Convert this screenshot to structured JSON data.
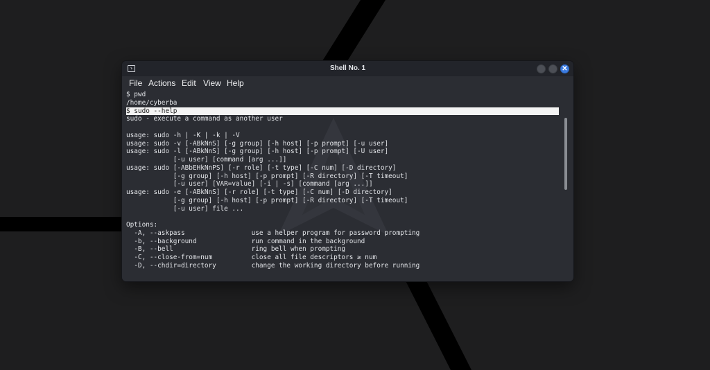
{
  "window": {
    "title": "Shell No. 1",
    "close_symbol": "✕",
    "icons": [
      "terminal-icon",
      "minimize-icon",
      "maximize-icon",
      "close-icon"
    ],
    "accent_color": "#3b7be0"
  },
  "menu": {
    "file": "File",
    "actions": "Actions",
    "edit": "Edit",
    "view": "View",
    "help": "Help"
  },
  "terminal": {
    "lines": [
      "$ pwd",
      "/home/cyberba",
      "$ sudo --help",
      "sudo - execute a command as another user",
      "",
      "usage: sudo -h | -K | -k | -V",
      "usage: sudo -v [-ABkNnS] [-g group] [-h host] [-p prompt] [-u user]",
      "usage: sudo -l [-ABkNnS] [-g group] [-h host] [-p prompt] [-U user]",
      "            [-u user] [command [arg ...]]",
      "usage: sudo [-ABbEHkNnPS] [-r role] [-t type] [-C num] [-D directory]",
      "            [-g group] [-h host] [-p prompt] [-R directory] [-T timeout]",
      "            [-u user] [VAR=value] [-i | -s] [command [arg ...]]",
      "usage: sudo -e [-ABkNnS] [-r role] [-t type] [-C num] [-D directory]",
      "            [-g group] [-h host] [-p prompt] [-R directory] [-T timeout]",
      "            [-u user] file ...",
      "",
      "Options:",
      "  -A, --askpass                 use a helper program for password prompting",
      "  -b, --background              run command in the background",
      "  -B, --bell                    ring bell when prompting",
      "  -C, --close-from=num          close all file descriptors ≥ num",
      "  -D, --chdir=directory         change the working directory before running"
    ],
    "highlighted_line": 2
  }
}
